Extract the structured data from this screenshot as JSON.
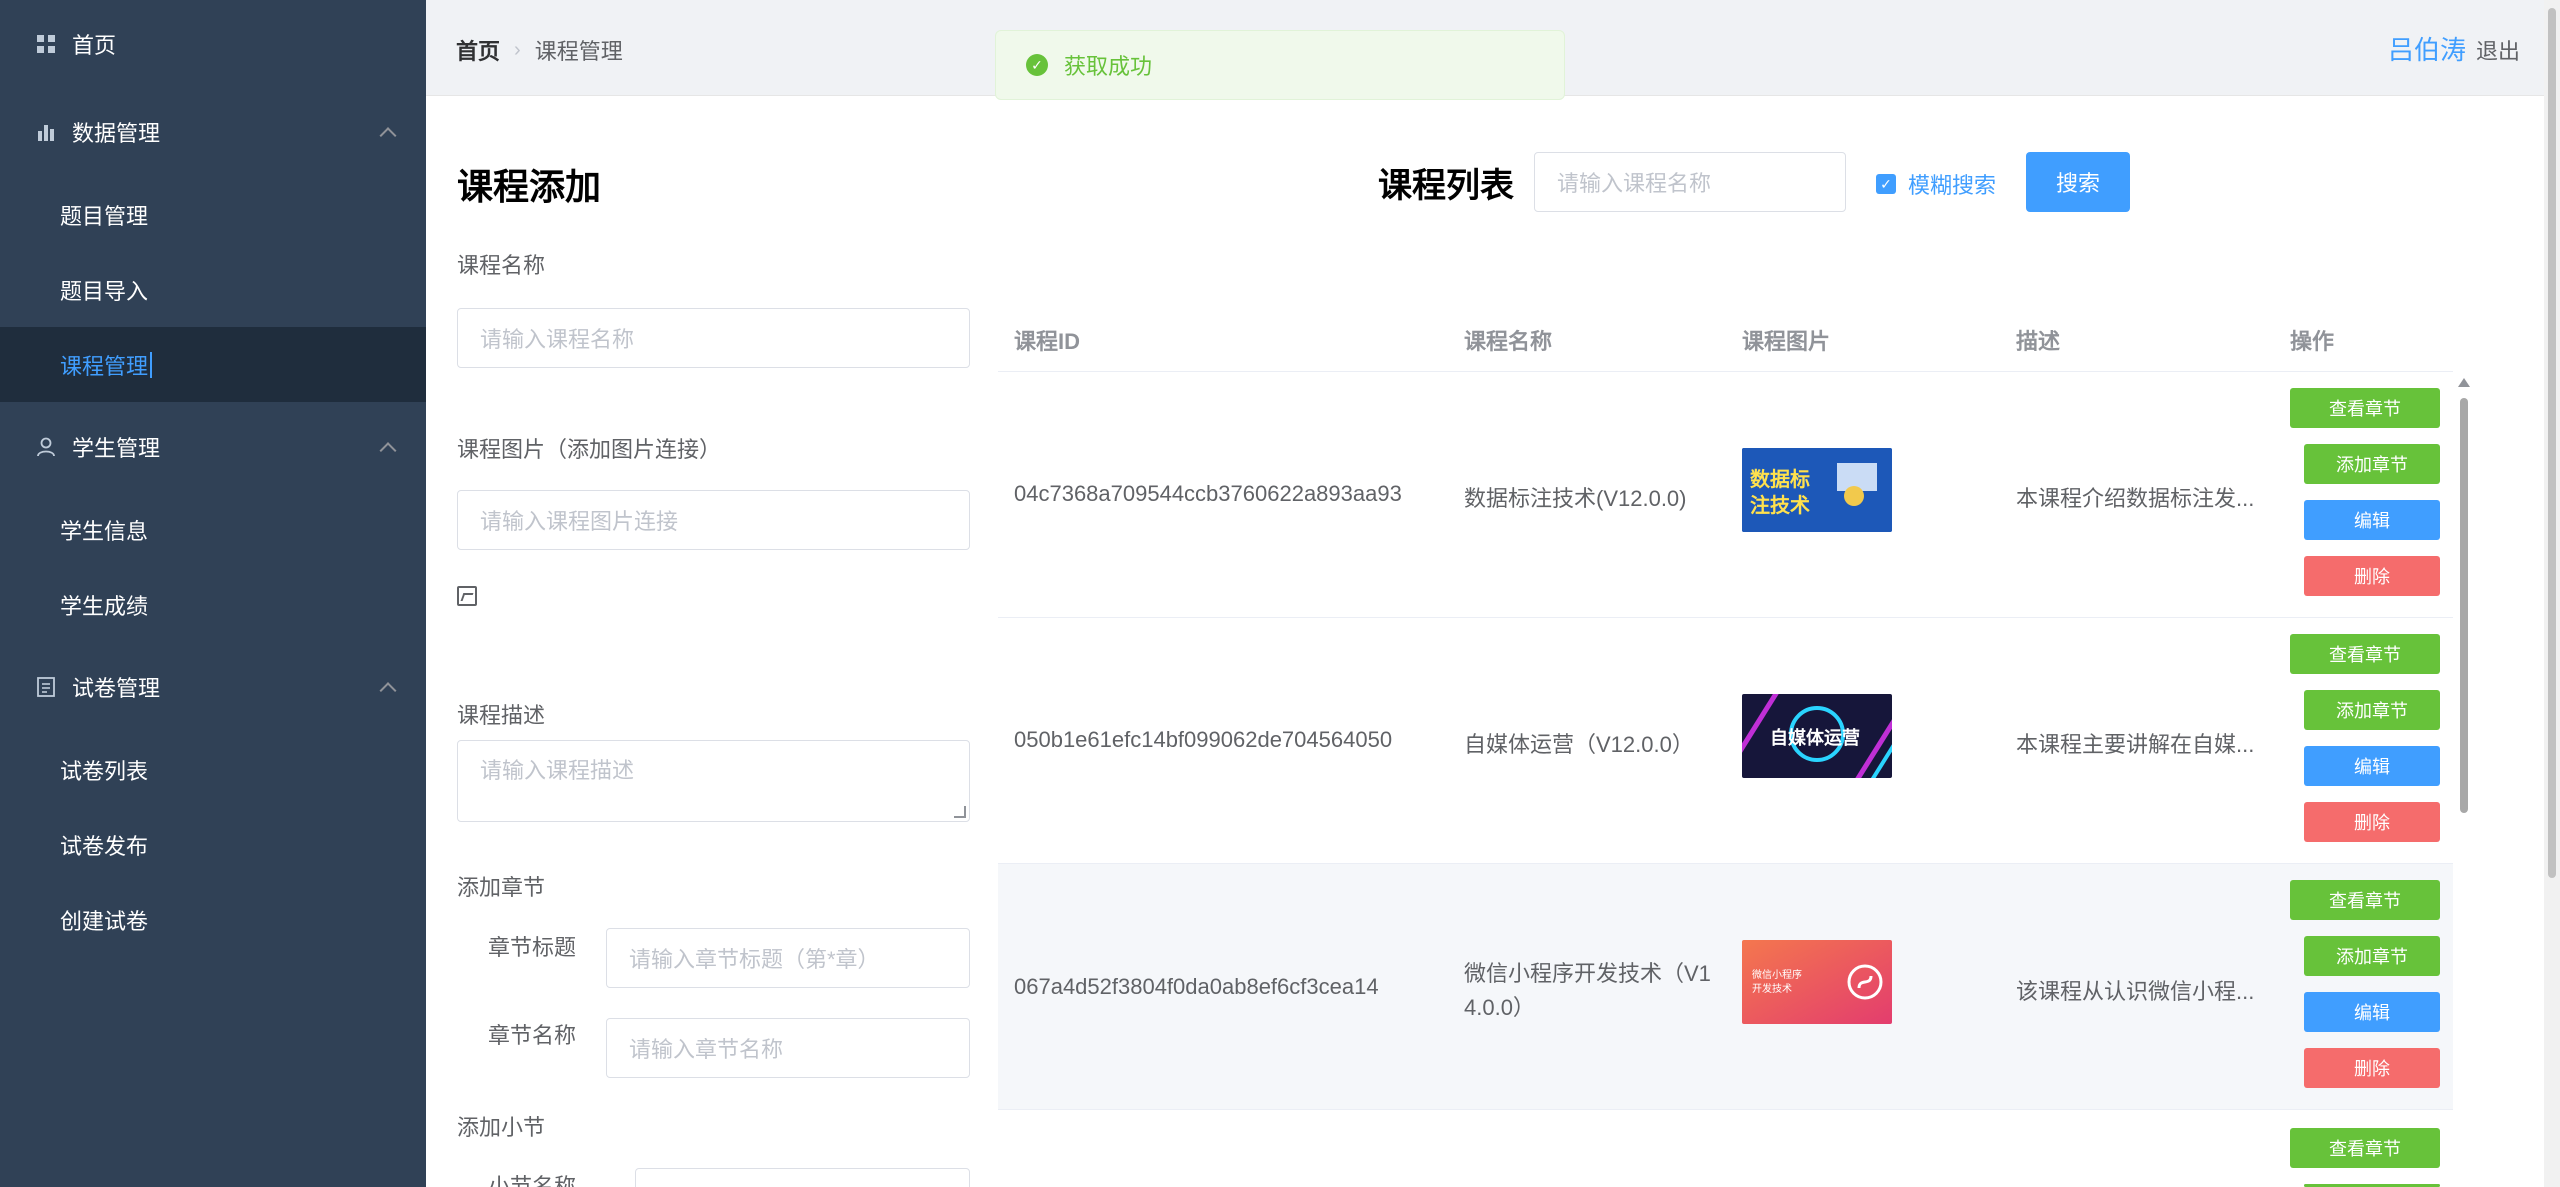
{
  "sidebar": {
    "home": "首页",
    "groups": [
      {
        "label": "数据管理",
        "items": [
          "题目管理",
          "题目导入",
          "课程管理"
        ]
      },
      {
        "label": "学生管理",
        "items": [
          "学生信息",
          "学生成绩"
        ]
      },
      {
        "label": "试卷管理",
        "items": [
          "试卷列表",
          "试卷发布",
          "创建试卷"
        ]
      }
    ],
    "active": "课程管理"
  },
  "header": {
    "breadcrumb_home": "首页",
    "breadcrumb_current": "课程管理",
    "user_name": "吕伯涛",
    "logout": "退出"
  },
  "toast": {
    "message": "获取成功"
  },
  "form": {
    "title": "课程添加",
    "name_label": "课程名称",
    "name_placeholder": "请输入课程名称",
    "image_label": "课程图片（添加图片连接）",
    "image_placeholder": "请输入课程图片连接",
    "desc_label": "课程描述",
    "desc_placeholder": "请输入课程描述",
    "add_chapter_label": "添加章节",
    "chapter_title_label": "章节标题",
    "chapter_title_placeholder": "请输入章节标题（第*章）",
    "chapter_name_label": "章节名称",
    "chapter_name_placeholder": "请输入章节名称",
    "add_section_label": "添加小节",
    "section_name_label": "小节名称"
  },
  "list": {
    "title": "课程列表",
    "search_placeholder": "请输入课程名称",
    "fuzzy_label": "模糊搜索",
    "fuzzy_checked": true,
    "search_button": "搜索",
    "columns": [
      "课程ID",
      "课程名称",
      "课程图片",
      "描述",
      "操作"
    ],
    "rows": [
      {
        "id": "04c7368a709544ccb3760622a893aa93",
        "name": "数据标注技术(V12.0.0)",
        "image_text": "数据标注技术",
        "desc": "本课程介绍数据标注发..."
      },
      {
        "id": "050b1e61efc14bf099062de704564050",
        "name": "自媒体运营（V12.0.0）",
        "image_text": "自媒体运营",
        "desc": "本课程主要讲解在自媒..."
      },
      {
        "id": "067a4d52f3804f0da0ab8ef6cf3cea14",
        "name_line1": "微信小程序开发技术（V1",
        "name_line2": "4.0.0）",
        "image_text": "微信小程序开发技术",
        "desc": "该课程从认识微信小程..."
      }
    ],
    "actions": {
      "view": "查看章节",
      "add": "添加章节",
      "edit": "编辑",
      "delete": "删除"
    }
  },
  "colors": {
    "primary": "#409eff",
    "success": "#67c23a",
    "danger": "#f56c6c",
    "sidebar": "#304156"
  }
}
